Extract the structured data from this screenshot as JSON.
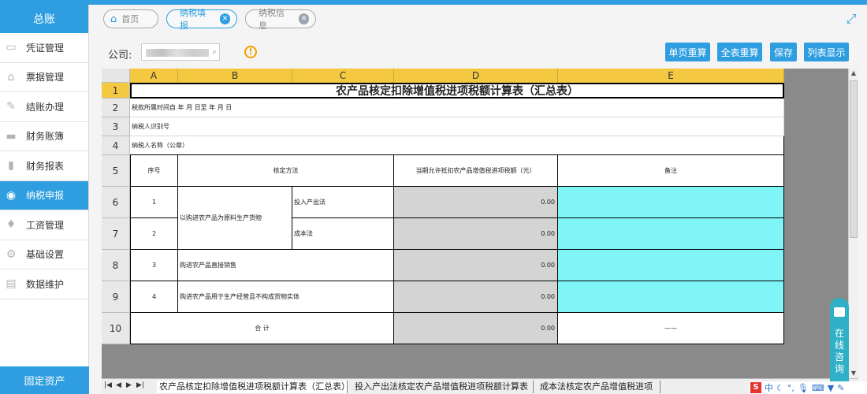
{
  "sidebar": {
    "header": "总账",
    "items": [
      {
        "label": "凭证管理",
        "icon": "voucher-icon",
        "active": false
      },
      {
        "label": "票据管理",
        "icon": "bill-icon",
        "active": false
      },
      {
        "label": "结账办理",
        "icon": "pencil-icon",
        "active": false
      },
      {
        "label": "财务账簿",
        "icon": "ledger-icon",
        "active": false
      },
      {
        "label": "财务报表",
        "icon": "bar-chart-icon",
        "active": false
      },
      {
        "label": "纳税申报",
        "icon": "tax-icon",
        "active": true
      },
      {
        "label": "工资管理",
        "icon": "money-bag-icon",
        "active": false
      },
      {
        "label": "基础设置",
        "icon": "settings-icon",
        "active": false
      },
      {
        "label": "数据维护",
        "icon": "database-icon",
        "active": false
      }
    ],
    "footer": "固定资产"
  },
  "tabs": [
    {
      "label": "首页"
    },
    {
      "label": "纳税填报"
    },
    {
      "label": "纳税信息"
    }
  ],
  "toolbar": {
    "company_label": "公司:",
    "buttons": [
      "单页重算",
      "全表重算",
      "保存",
      "列表显示"
    ]
  },
  "sheet": {
    "columns": [
      "A",
      "B",
      "C",
      "D",
      "E"
    ],
    "rows": [
      "1",
      "2",
      "3",
      "4",
      "5",
      "6",
      "7",
      "8",
      "9",
      "10"
    ],
    "title": "农产品核定扣除增值税进项税额计算表（汇总表）",
    "r2": "税款所属时间自      年      月      日至      年      月      日",
    "r3": "纳税人识别号",
    "r4": "纳税人名称（公章）",
    "h_seq": "序号",
    "h_method": "核定方法",
    "h_amount": "当期允许抵扣农产品增值税进项税额（元）",
    "h_note": "备注",
    "seq1": "1",
    "seq2": "2",
    "seq3": "3",
    "seq4": "4",
    "m12": "以购进农产品为原料生产货物",
    "m1": "投入产出法",
    "m2": "成本法",
    "m3": "购进农产品直接销售",
    "m4": "购进农产品用于生产经营且不构成货物实体",
    "v1": "0.00",
    "v2": "0.00",
    "v3": "0.00",
    "v4": "0.00",
    "total_label": "合        计",
    "total_value": "0.00",
    "total_note": "——"
  },
  "sheet_tabs": [
    "农产品核定扣除增值税进项税额计算表（汇总表）",
    "投入产出法核定农产品增值税进项税额计算表",
    "成本法核定农产品增值税进项"
  ],
  "consult": "在线咨询",
  "ime": "中"
}
